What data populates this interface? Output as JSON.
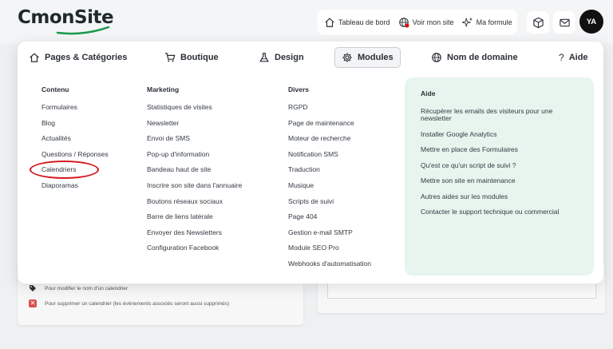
{
  "brand": {
    "logo_text": "CmonSite",
    "accent": "#1a9a4a"
  },
  "header": {
    "quicklinks": [
      {
        "label": "Tableau de bord",
        "icon": "home-icon"
      },
      {
        "label": "Voir mon site",
        "icon": "globe-icon"
      },
      {
        "label": "Ma formule",
        "icon": "sparkle-icon"
      }
    ],
    "actions": [
      {
        "icon": "box-icon"
      },
      {
        "icon": "mail-icon"
      }
    ],
    "avatar_initials": "YA"
  },
  "nav": {
    "items": [
      {
        "label": "Pages & Catégories",
        "icon": "home-icon"
      },
      {
        "label": "Boutique",
        "icon": "cart-icon"
      },
      {
        "label": "Design",
        "icon": "flask-icon"
      },
      {
        "label": "Modules",
        "icon": "gear-icon",
        "active": true
      },
      {
        "label": "Nom de domaine",
        "icon": "globe-icon"
      },
      {
        "label": "Aide",
        "icon": "question-icon"
      }
    ]
  },
  "menu": {
    "columns": [
      {
        "title": "Contenu",
        "items": [
          "Formulaires",
          "Blog",
          "Actualités",
          "Questions / Réponses",
          "Calendriers",
          "Diaporamas"
        ]
      },
      {
        "title": "Marketing",
        "items": [
          "Statistiques de visites",
          "Newsletter",
          "Envoi de SMS",
          "Pop-up d'information",
          "Bandeau haut de site",
          "Inscrire son site dans l'annuaire",
          "Boutons réseaux sociaux",
          "Barre de liens latérale",
          "Envoyer des Newsletters",
          "Configuration Facebook"
        ]
      },
      {
        "title": "Divers",
        "items": [
          "RGPD",
          "Page de maintenance",
          "Moteur de recherche",
          "Notification SMS",
          "Traduction",
          "Musique",
          "Scripts de suivi",
          "Page 404",
          "Gestion e-mail SMTP",
          "Module SEO Pro",
          "Webhooks d'automatisation"
        ]
      }
    ],
    "help": {
      "title": "Aide",
      "items": [
        "Récupérer les emails des visiteurs pour une newsletter",
        "Installer Google Analytics",
        "Mettre en place des Formulaires",
        "Qu'est ce qu'un script de suivi ?",
        "Mettre son site en maintenance",
        "Autres aides sur les modules",
        "Contacter le support technique ou commercial"
      ],
      "bg": "#e8f4ee"
    },
    "highlight_color": "#d4161c"
  },
  "background": {
    "notes": [
      {
        "text": "Pour modifier le nom d'un calendrier",
        "icon": "tag-icon"
      },
      {
        "text": "Pour supprimer un calendrier (les évènements associés seront aussi supprimés)",
        "icon": "delete-icon"
      }
    ]
  }
}
